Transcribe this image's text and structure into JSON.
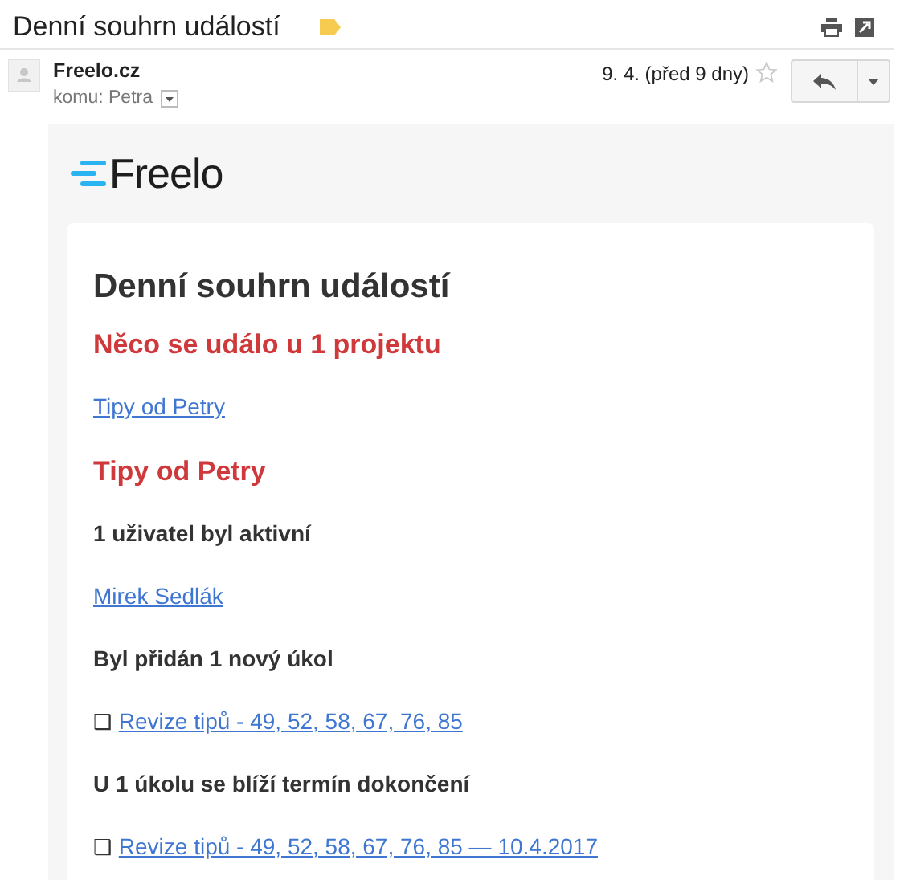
{
  "subject": "Denní souhrn událostí",
  "label": {
    "color": "#f6cb4f"
  },
  "sender": {
    "name": "Freelo.cz",
    "to": "komu: Petra",
    "date": "9. 4. (před 9 dny)",
    "starred": false
  },
  "logo": {
    "text": "Freelo"
  },
  "blocks": [
    {
      "kind": "title",
      "text": "Denní souhrn událostí"
    },
    {
      "kind": "red",
      "text": "Něco se událo u 1 projektu"
    },
    {
      "kind": "link",
      "text": "Tipy od Petry"
    },
    {
      "kind": "red",
      "text": "Tipy od Petry"
    },
    {
      "kind": "bold",
      "text": "1 uživatel byl aktivní"
    },
    {
      "kind": "link",
      "text": "Mirek Sedlák"
    },
    {
      "kind": "bold",
      "text": "Byl přidán 1 nový úkol"
    },
    {
      "kind": "task",
      "bullet": "❑",
      "text": "Revize tipů - 49, 52, 58, 67, 76, 85"
    },
    {
      "kind": "bold",
      "text": "U 1 úkolu se blíží termín dokončení"
    },
    {
      "kind": "task",
      "bullet": "❑",
      "text": "Revize tipů - 49, 52, 58, 67, 76, 85 — 10.4.2017"
    }
  ]
}
